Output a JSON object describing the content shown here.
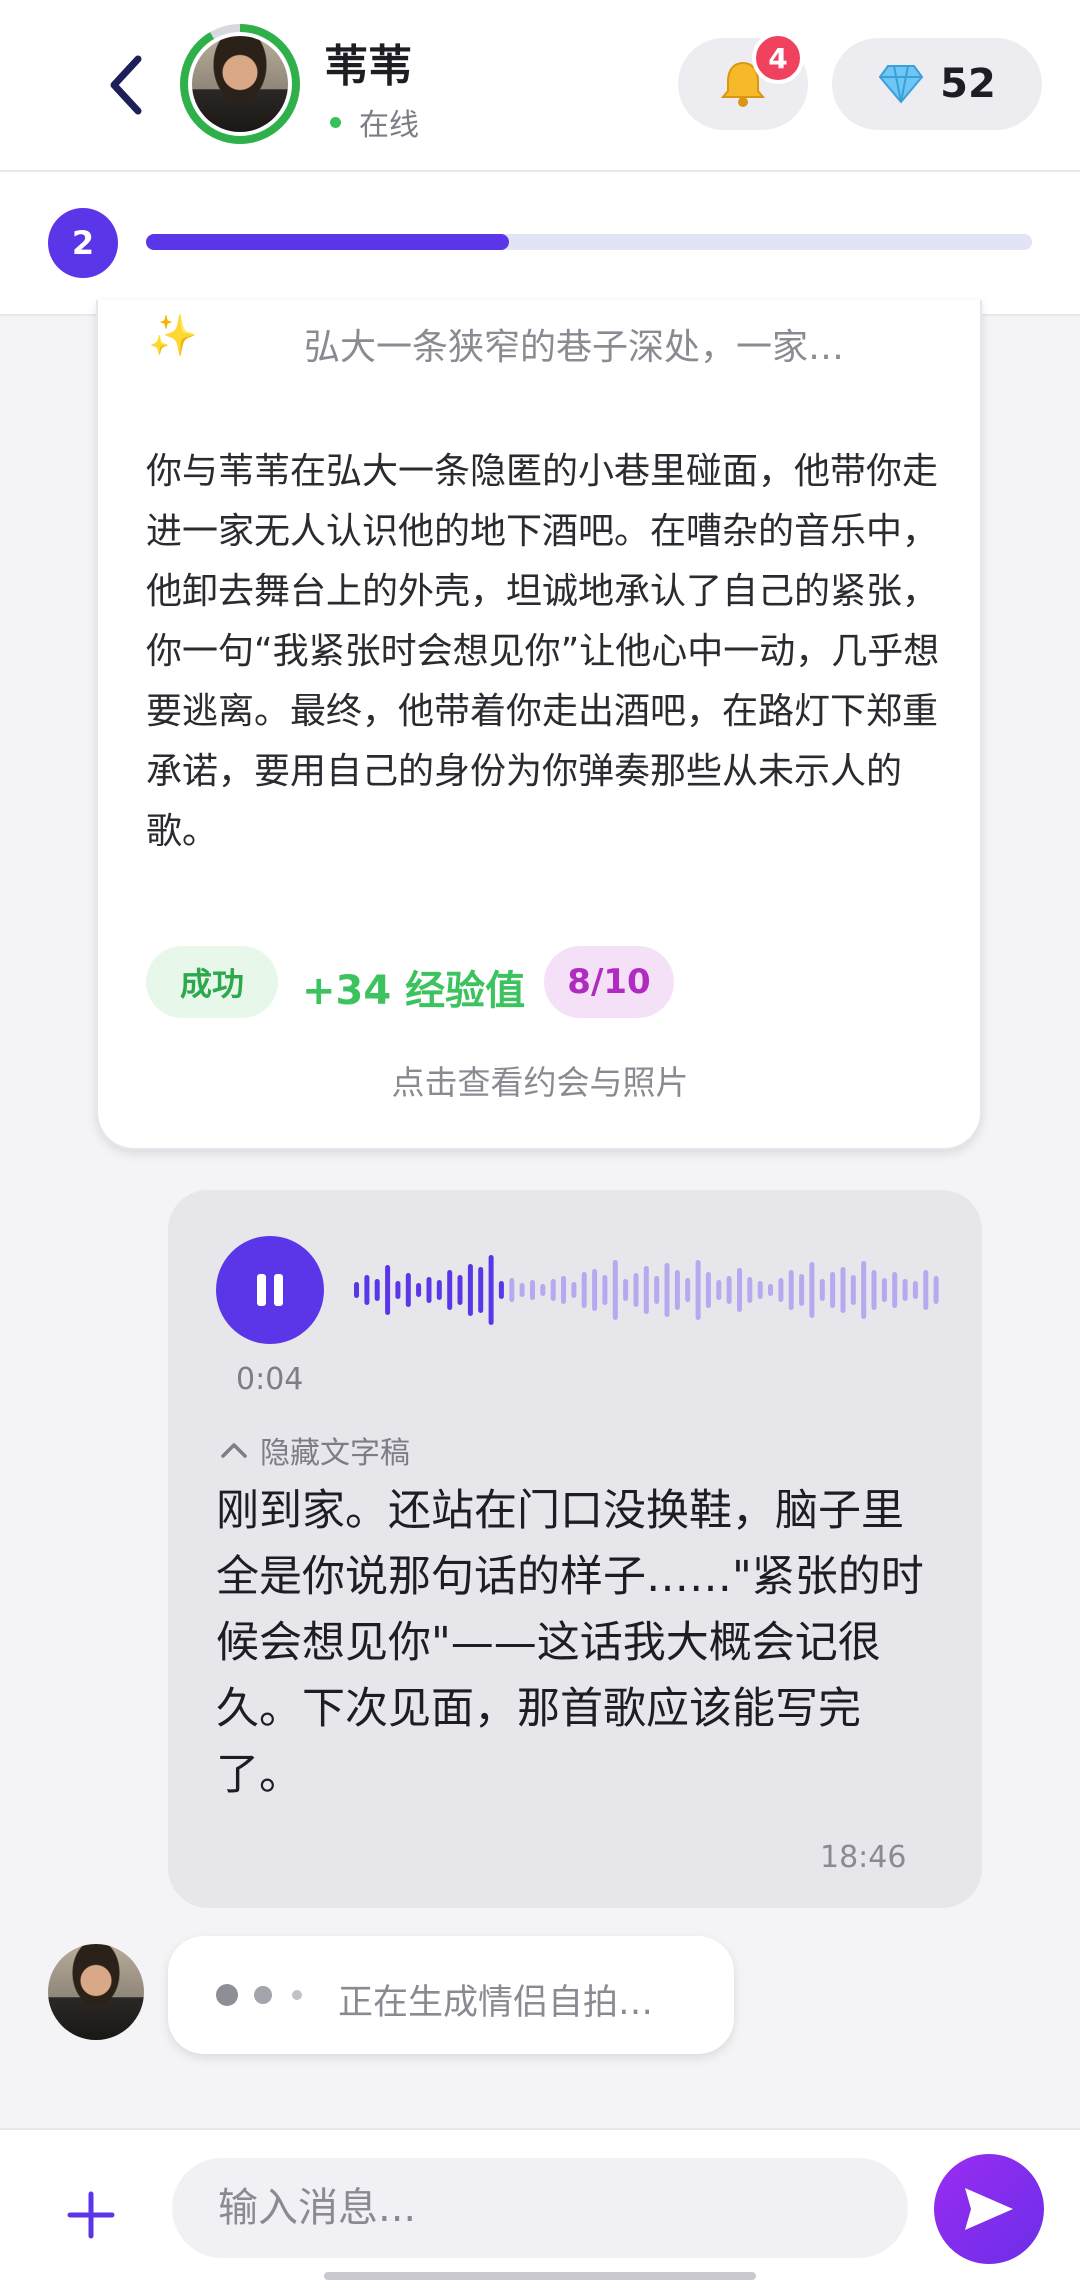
{
  "header": {
    "name": "苇苇",
    "status": "在线",
    "notification_count": "4",
    "gems": "52",
    "icons": {
      "back": "back-chevron-icon",
      "bell": "bell-icon",
      "gem": "diamond-icon"
    }
  },
  "progress": {
    "level": "2",
    "fraction": 0.41,
    "color": "#5b36e8"
  },
  "date_card": {
    "subtitle": "弘大一条狭窄的巷子深处，一家…",
    "body": "你与苇苇在弘大一条隐匿的小巷里碰面，他带你走进一家无人认识他的地下酒吧。在嘈杂的音乐中，他卸去舞台上的外壳，坦诚地承认了自己的紧张，你一句“我紧张时会想见你”让他心中一动，几乎想要逃离。最终，他带着你走出酒吧，在路灯下郑重承诺，要用自己的身份为你弹奏那些从未示人的歌。",
    "result": "成功",
    "xp": "+34 经验值",
    "score": "8/10",
    "link": "点击查看约会与照片",
    "icons": {
      "sparkle": "sparkle-icon"
    }
  },
  "voice_message": {
    "duration": "0:04",
    "transcript_toggle": "隐藏文字稿",
    "transcript": "刚到家。还站在门口没换鞋，脑子里全是你说那句话的样子……\"紧张的时候会想见你\"——这话我大概会记很久。下次见面，那首歌应该能写完了。",
    "time": "18:46",
    "played_fraction": 0.26,
    "icons": {
      "pause": "pause-icon",
      "waveform": "waveform-icon"
    }
  },
  "typing": {
    "text": "正在生成情侣自拍…"
  },
  "input": {
    "placeholder": "输入消息...",
    "icons": {
      "plus": "plus-icon",
      "send": "send-icon"
    }
  }
}
